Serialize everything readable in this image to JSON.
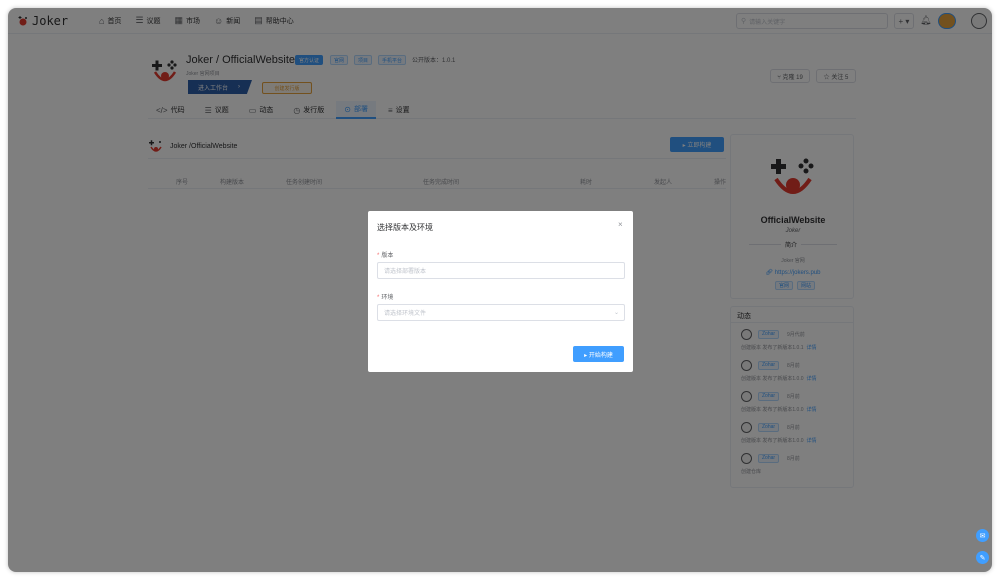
{
  "app": {
    "logo_text": "Joker"
  },
  "nav": [
    {
      "icon": "home-icon",
      "glyph": "⌂",
      "label": "首页"
    },
    {
      "icon": "list-icon",
      "glyph": "☰",
      "label": "议题"
    },
    {
      "icon": "market-icon",
      "glyph": "▦",
      "label": "市场"
    },
    {
      "icon": "user-icon",
      "glyph": "☺",
      "label": "新闻"
    },
    {
      "icon": "doc-icon",
      "glyph": "▤",
      "label": "帮助中心"
    }
  ],
  "search": {
    "placeholder": "请输入关键字"
  },
  "toolbar": {
    "plus": "+ ▾"
  },
  "repo": {
    "title": "Joker / OfficialWebsite",
    "tags": [
      "官方认证",
      "官网",
      "项目",
      "手机平台"
    ],
    "public_version": "公开版本：1.0.1",
    "subtitle": "Joker 官网项目",
    "enter_button": "进入工作台",
    "secondary_button": "创建发行版",
    "star": "⑂ 克隆 19",
    "watch": "☆ 关注 5"
  },
  "tabs": [
    {
      "glyph": "</>",
      "label": "代码",
      "active": false
    },
    {
      "glyph": "☰",
      "label": "议题",
      "active": false
    },
    {
      "glyph": "▭",
      "label": "动态",
      "active": false
    },
    {
      "glyph": "◷",
      "label": "发行版",
      "active": false
    },
    {
      "glyph": "⊙",
      "label": "部署",
      "active": true
    },
    {
      "glyph": "≡",
      "label": "设置",
      "active": false
    }
  ],
  "panel": {
    "title": "Joker /OfficialWebsite",
    "build_button": "▸ 立即构建",
    "columns": [
      "序号",
      "构建版本",
      "任务创建时间",
      "任务完成时间",
      "耗时",
      "发起人",
      "操作"
    ]
  },
  "sidebar": {
    "name": "OfficialWebsite",
    "owner": "Joker",
    "intro_label": "简介",
    "desc": "Joker 官网",
    "link": "https://jokers.pub",
    "tags": [
      "官网",
      "网站"
    ]
  },
  "activity": {
    "title": "动态",
    "items": [
      {
        "user": "Zohar",
        "time": "9月代前",
        "msg": "创建版本 发布了新版本1.0.1",
        "link": "详情"
      },
      {
        "user": "Zohar",
        "time": "8月前",
        "msg": "创建版本 发布了新版本1.0.0",
        "link": "详情"
      },
      {
        "user": "Zohar",
        "time": "8月前",
        "msg": "创建版本 发布了新版本1.0.0",
        "link": "详情"
      },
      {
        "user": "Zohar",
        "time": "8月前",
        "msg": "创建版本 发布了新版本1.0.0",
        "link": "详情"
      },
      {
        "user": "Zohar",
        "time": "8月前",
        "msg": "创建仓库",
        "link": ""
      }
    ]
  },
  "modal": {
    "title": "选择版本及环境",
    "close": "×",
    "version_label": "版本",
    "version_placeholder": "请选择部署版本",
    "env_label": "环境",
    "env_placeholder": "请选择环境文件",
    "start_button": "▸ 开始构建"
  },
  "colors": {
    "primary": "#409eff",
    "accent": "#2d5fa8",
    "overlay": "rgba(0,0,0,0.5)"
  }
}
